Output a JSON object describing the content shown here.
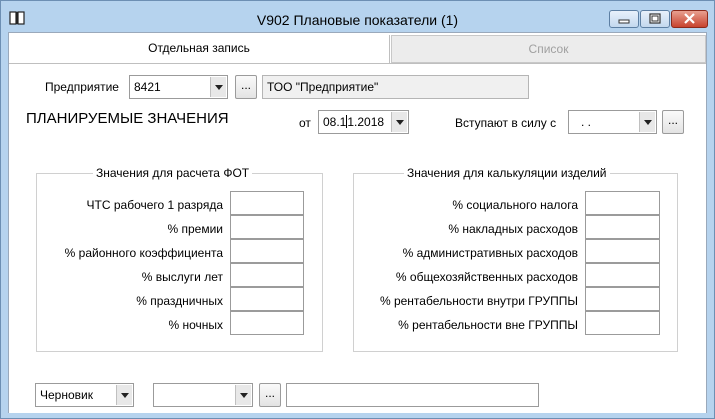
{
  "window": {
    "title": "V902 Плановые показатели (1)",
    "accent": "#b6d3ee"
  },
  "tabs": [
    {
      "label": "Отдельная запись",
      "active": true
    },
    {
      "label": "Список",
      "active": false
    }
  ],
  "enterprise": {
    "label": "Предприятие",
    "code": "8421",
    "browse_label": "...",
    "name": "ТОО \"Предприятие\""
  },
  "planned": {
    "heading": "ПЛАНИРУЕМЫЕ ЗНАЧЕНИЯ",
    "from_label": "от",
    "date_before_cursor": "08.1",
    "date_after_cursor": "1.2018",
    "effective_label": "Вступают в силу с",
    "effective_value": ". .",
    "effective_browse_label": "..."
  },
  "fot_group": {
    "title": "Значения для расчета ФОТ",
    "rows": [
      {
        "label": "ЧТС рабочего 1 разряда",
        "value": ""
      },
      {
        "label": "% премии",
        "value": ""
      },
      {
        "label": "% районного коэффициента",
        "value": ""
      },
      {
        "label": "% выслуги лет",
        "value": ""
      },
      {
        "label": "% праздничных",
        "value": ""
      },
      {
        "label": "% ночных",
        "value": ""
      }
    ]
  },
  "calc_group": {
    "title": "Значения для калькуляции изделий",
    "rows": [
      {
        "label": "% социального налога",
        "value": ""
      },
      {
        "label": "% накладных расходов",
        "value": ""
      },
      {
        "label": "% административных расходов",
        "value": ""
      },
      {
        "label": "% общехозяйственных расходов",
        "value": ""
      },
      {
        "label": "% рентабельности внутри ГРУППЫ",
        "value": ""
      },
      {
        "label": "% рентабельности вне ГРУППЫ",
        "value": ""
      }
    ]
  },
  "footer": {
    "status_value": "Черновик",
    "second_select_value": "",
    "browse_label": "...",
    "text_value": ""
  }
}
